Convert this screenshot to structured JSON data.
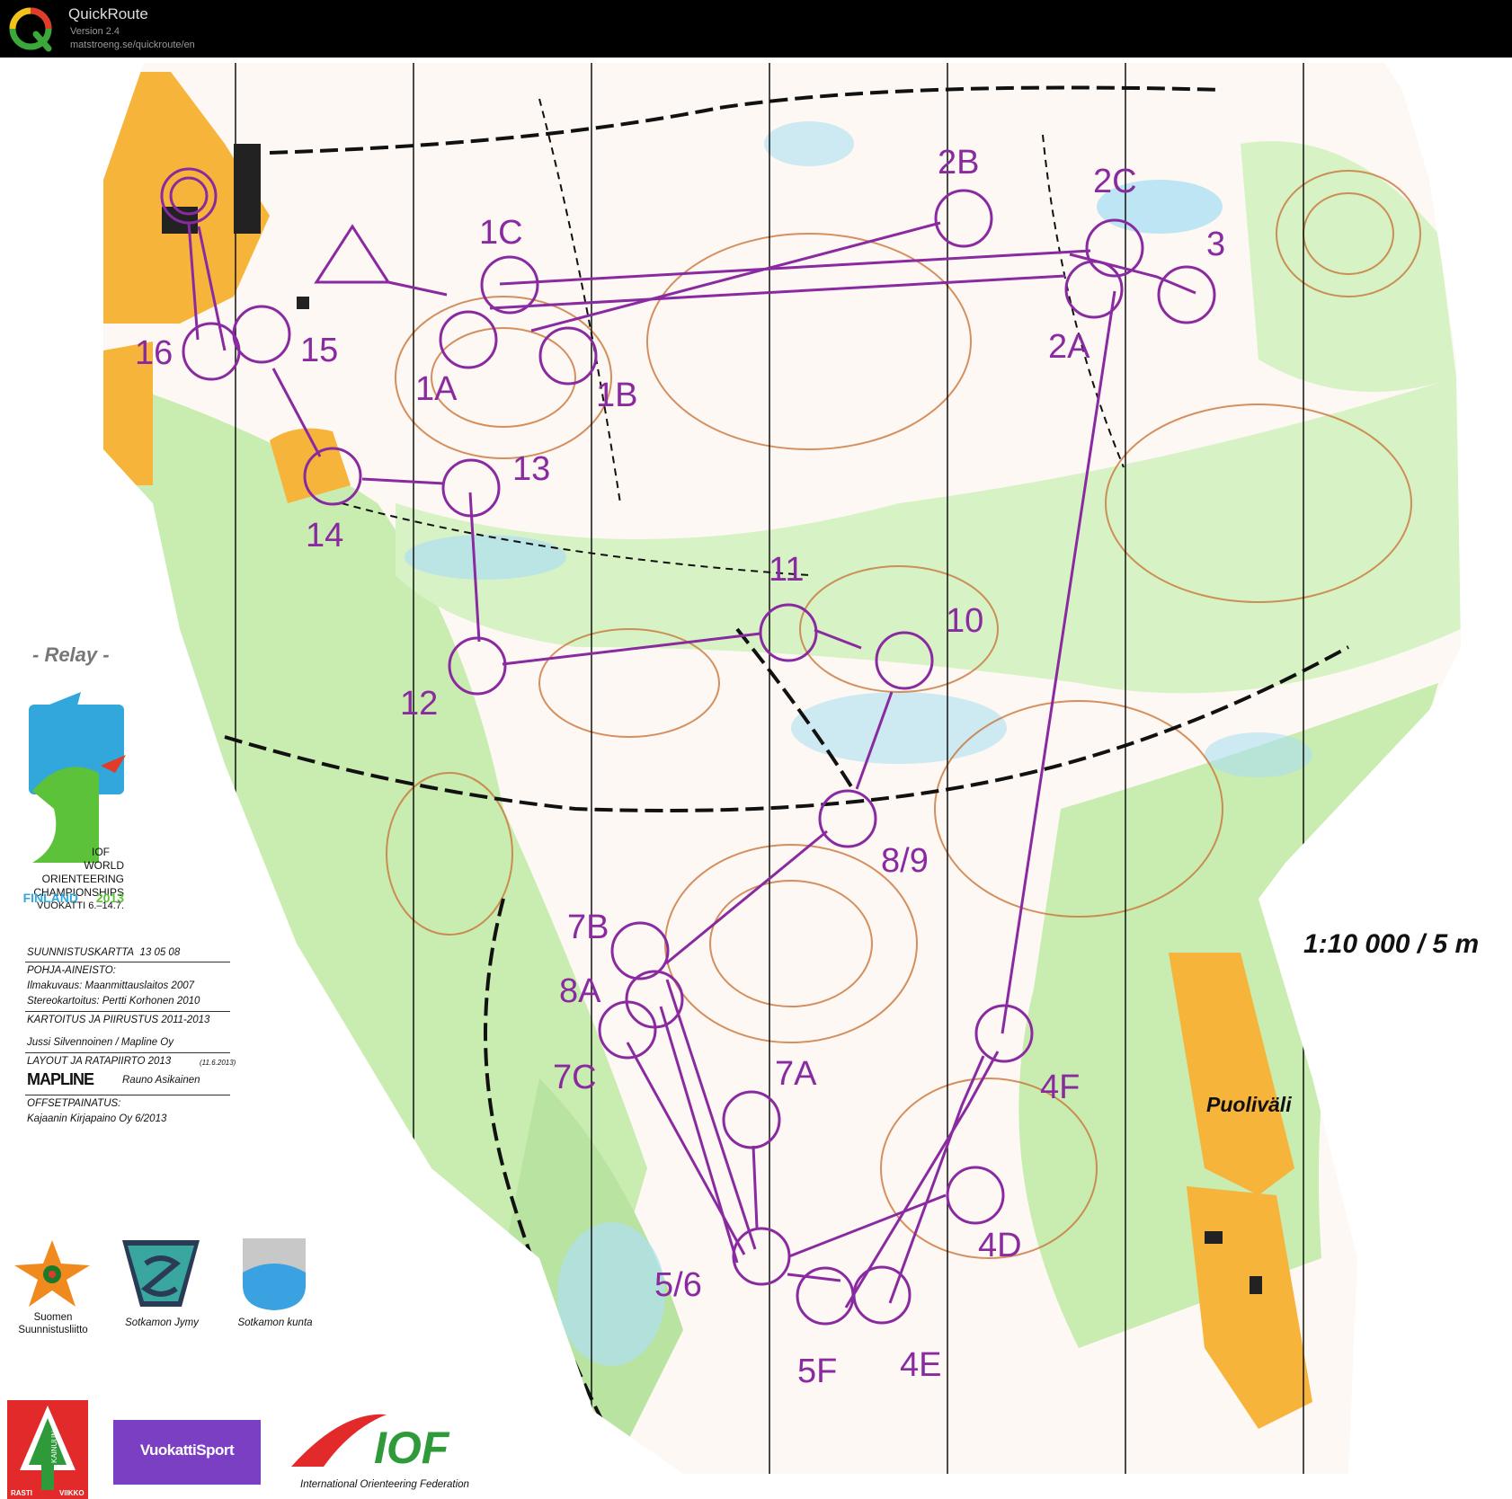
{
  "app": {
    "title": "QuickRoute",
    "version": "Version 2.4",
    "url": "matstroeng.se/quickroute/en"
  },
  "map": {
    "event_tag": "- Relay -",
    "scale": "1:10 000 / 5 m",
    "place_name": "Puoliväli",
    "course_color": "#8a2aa0",
    "controls": [
      "1A",
      "1B",
      "1C",
      "2A",
      "2B",
      "2C",
      "3",
      "4D",
      "4E",
      "4F",
      "5/6",
      "5F",
      "7A",
      "7B",
      "7C",
      "8A",
      "8/9",
      "10",
      "11",
      "12",
      "13",
      "14",
      "15",
      "16"
    ]
  },
  "wocLogo": {
    "line1": "IOF",
    "line2": "WORLD",
    "line3": "ORIENTEERING",
    "line4": "CHAMPIONSHIPS",
    "line5": "VUOKATTI 6.–14.7.",
    "line6a": "FINLAND",
    "line6b": "2013"
  },
  "credits": {
    "title": "SUUNNISTUSKARTTA",
    "code": "13 05 08",
    "base_heading": "POHJA-AINEISTO:",
    "base_line1": "Ilmakuvaus: Maanmittauslaitos 2007",
    "base_line2": "Stereokartoitus: Pertti Korhonen 2010",
    "mapping_heading": "KARTOITUS JA PIIRUSTUS 2011-2013",
    "mapping_line": "Jussi Silvennoinen / Mapline Oy",
    "layout_heading": "LAYOUT JA RATAPIIRTO 2013",
    "layout_date": "(11.6.2013)",
    "mapline": "MAPLINE",
    "layout_name": "Rauno Asikainen",
    "print_heading": "OFFSETPAINATUS:",
    "print_line": "Kajaanin Kirjapaino Oy 6/2013"
  },
  "sponsors": {
    "ssl_line1": "Suomen",
    "ssl_line2": "Suunnistusliitto",
    "jymy": "Sotkamon Jymy",
    "kunta": "Sotkamon kunta",
    "rasti_left": "RASTI",
    "rasti_right": "VIIKKO",
    "rasti_vertical": "KAINUUN",
    "vuokatti": "VuokattiSport",
    "iof_mark": "IOF",
    "iof_full": "International Orienteering Federation"
  }
}
